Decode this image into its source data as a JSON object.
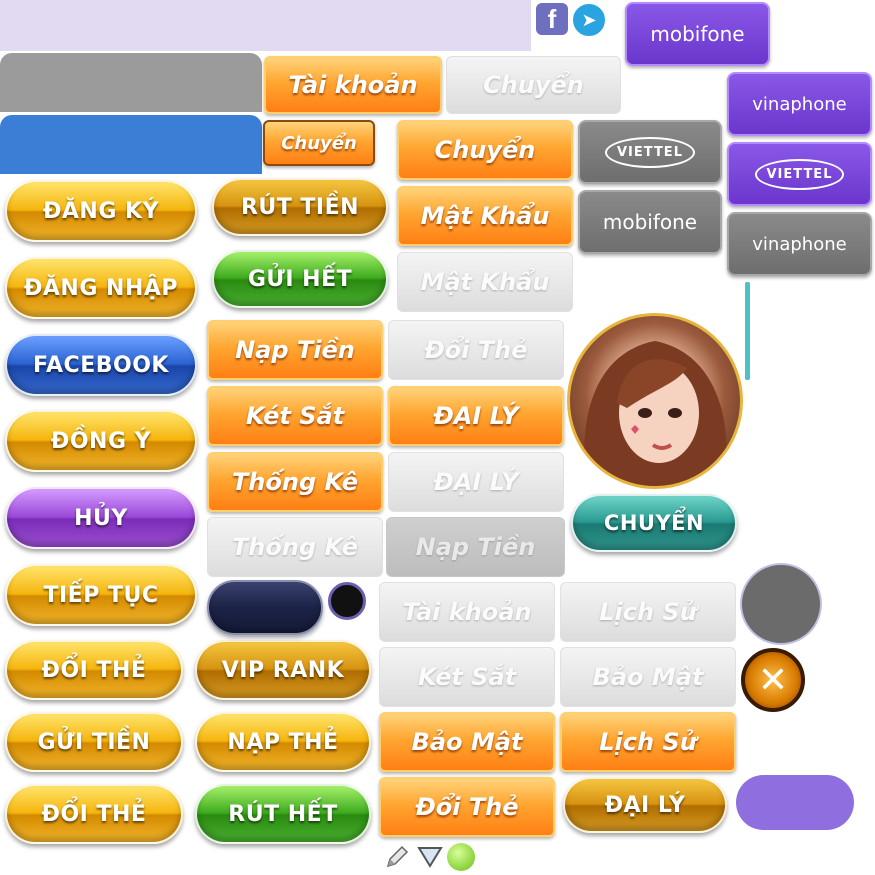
{
  "social": {
    "facebook_glyph": "f",
    "telegram_glyph": "➤"
  },
  "carriers": {
    "mobifone": "mobifone",
    "vinaphone": "vinaphone",
    "viettel": "VIETTEL"
  },
  "orange_buttons": {
    "tai_khoan": "Tài khoản",
    "chuyen": "Chuyển",
    "mat_khau": "Mật Khẩu",
    "nap_tien": "Nạp Tiền",
    "ket_sat": "Két Sắt",
    "dai_ly": "ĐẠI LÝ",
    "thong_ke": "Thống Kê",
    "bao_mat": "Bảo Mật",
    "lich_su": "Lịch Sử",
    "doi_the": "Đổi Thẻ"
  },
  "ghost_buttons": {
    "chuyen": "Chuyển",
    "mat_khau": "Mật Khẩu",
    "doi_the": "Đổi Thẻ",
    "dai_ly": "ĐẠI LÝ",
    "thong_ke": "Thống Kê",
    "nap_tien": "Nạp Tiền",
    "tai_khoan": "Tài khoản",
    "lich_su": "Lịch Sử",
    "ket_sat": "Két Sắt",
    "bao_mat": "Bảo Mật"
  },
  "small_button": {
    "chuyen": "Chuyển"
  },
  "pill_buttons": {
    "dang_ky": "ĐĂNG KÝ",
    "rut_tien": "RÚT TIỀN",
    "dang_nhap": "ĐĂNG NHẬP",
    "gui_het": "GỬI HẾT",
    "facebook": "FACEBOOK",
    "dong_y": "ĐỒNG Ý",
    "huy": "HỦY",
    "tiep_tuc": "TIẾP TỤC",
    "doi_the": "ĐỔI THẺ",
    "vip_rank": "VIP RANK",
    "gui_tien": "GỬI TIỀN",
    "nap_the": "NẠP THẺ",
    "doi_the_2": "ĐỔI THẺ",
    "rut_het": "RÚT HẾT",
    "chuyen": "CHUYỂN",
    "dai_ly": "ĐẠI LÝ"
  },
  "close_glyph": "✕",
  "colors": {
    "lavender_bar": "#e2d9f3",
    "gray_bar": "#9b9b9b",
    "blue_bar": "#3a7fd5",
    "teal_line": "#4ac2c8",
    "gray_circle": "#6b6b6b",
    "lilac_pill": "#8f6ee0"
  }
}
